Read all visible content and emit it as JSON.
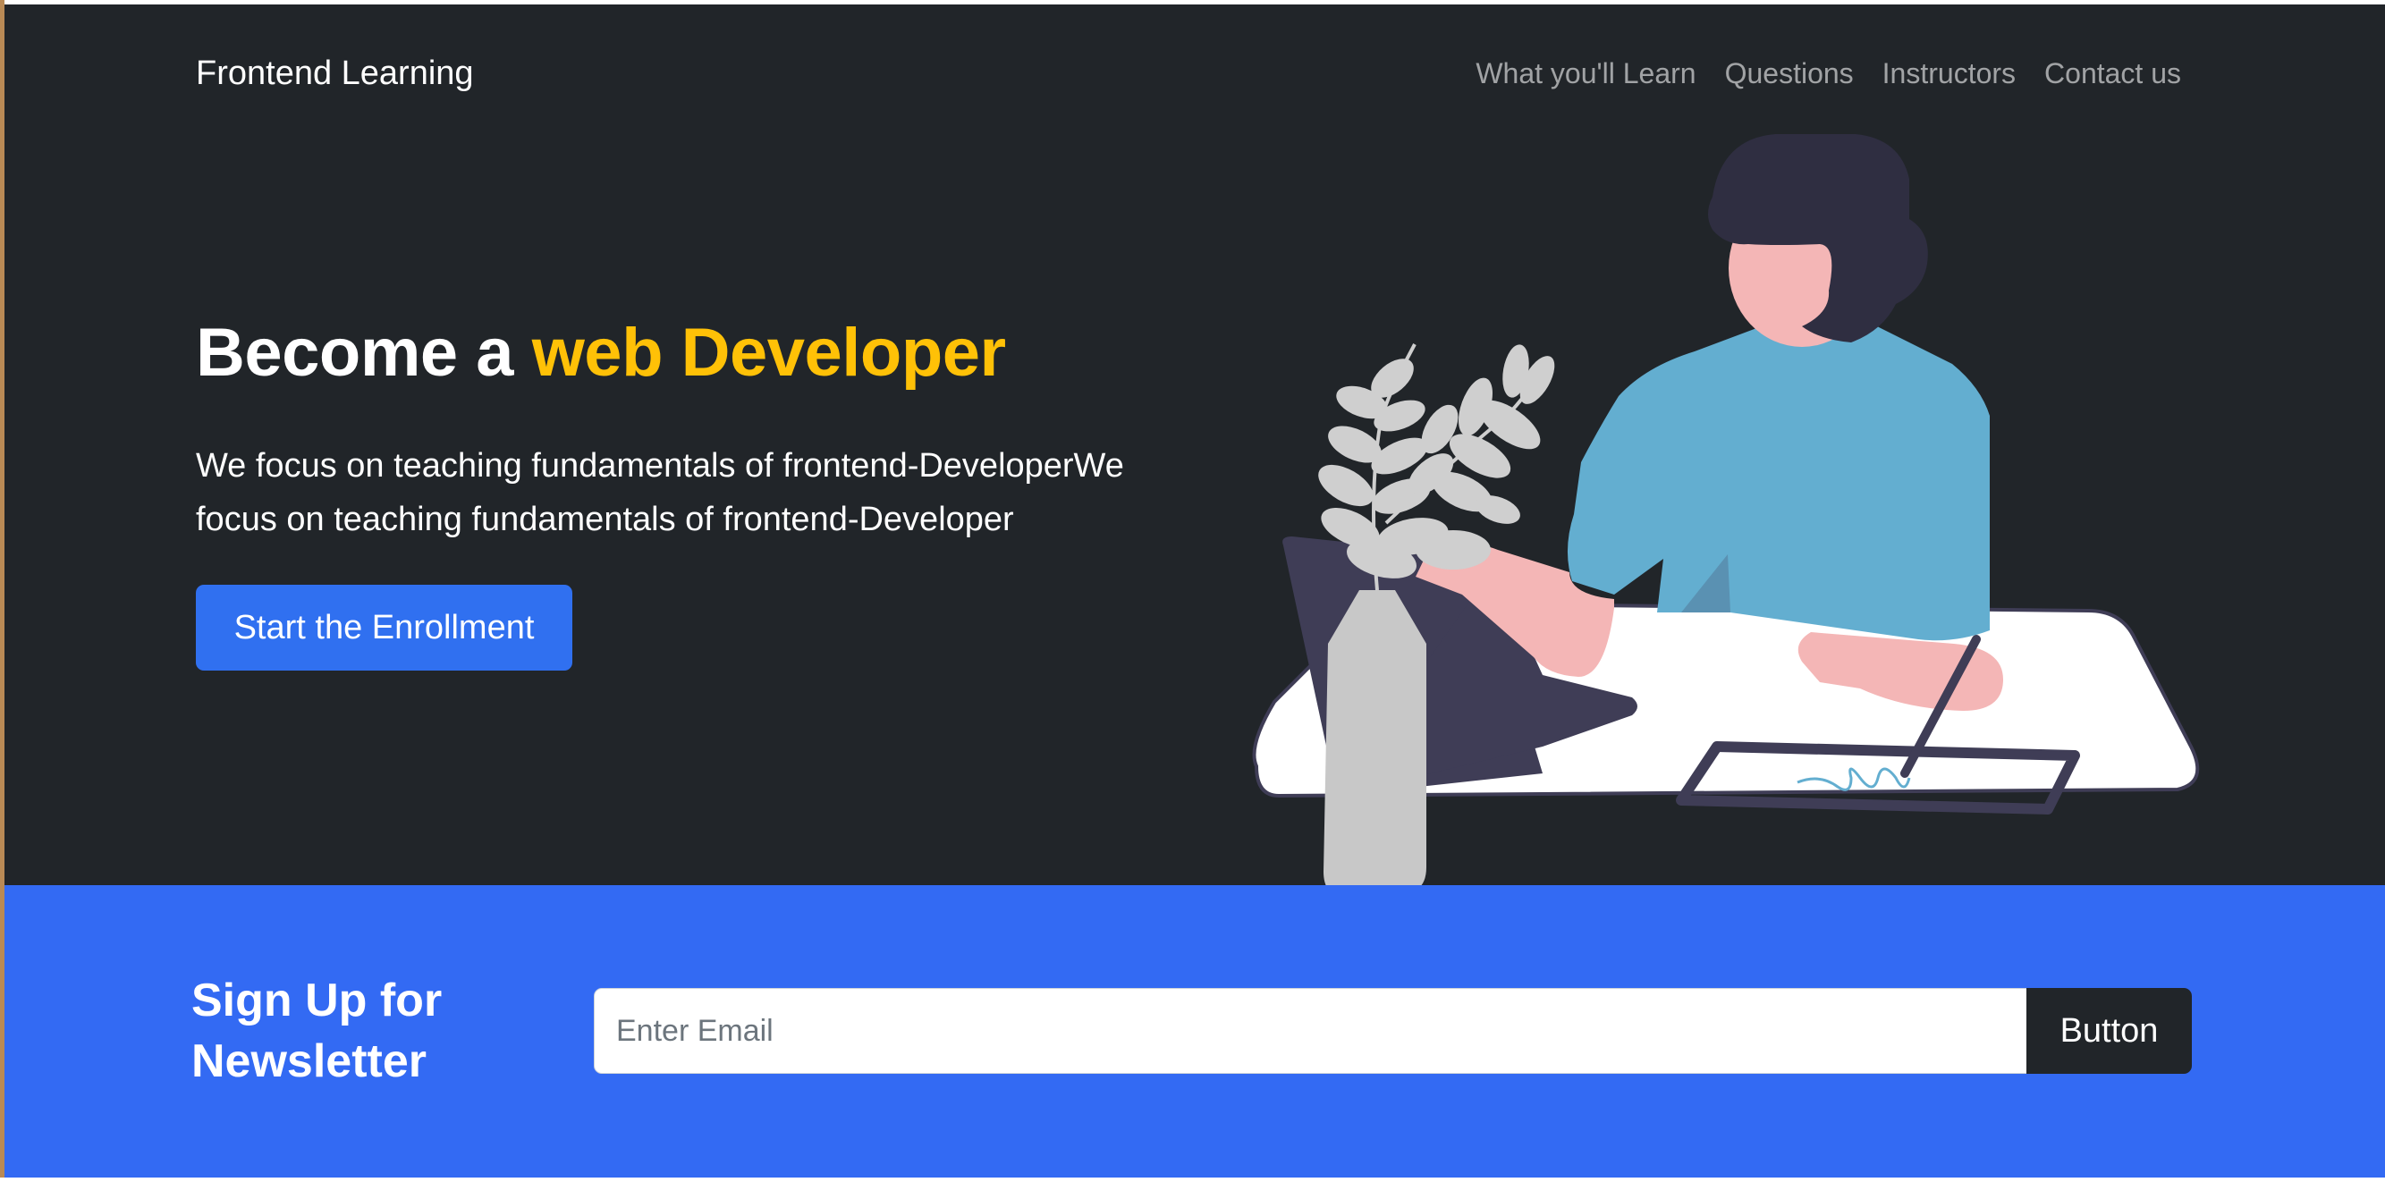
{
  "navbar": {
    "brand": "Frontend Learning",
    "links": [
      "What you'll Learn",
      "Questions",
      "Instructors",
      "Contact us"
    ]
  },
  "hero": {
    "headline_prefix": "Become a ",
    "headline_accent": "web Developer",
    "lead": "We focus on teaching fundamentals of frontend-DeveloperWe focus on teaching fundamentals of frontend-Developer",
    "cta_label": "Start the Enrollment",
    "accent_color": "#ffc107",
    "background_color": "#212529"
  },
  "newsletter": {
    "title": "Sign Up for Newsletter",
    "email_placeholder": "Enter Email",
    "button_label": "Button",
    "background_color": "#336af3"
  }
}
